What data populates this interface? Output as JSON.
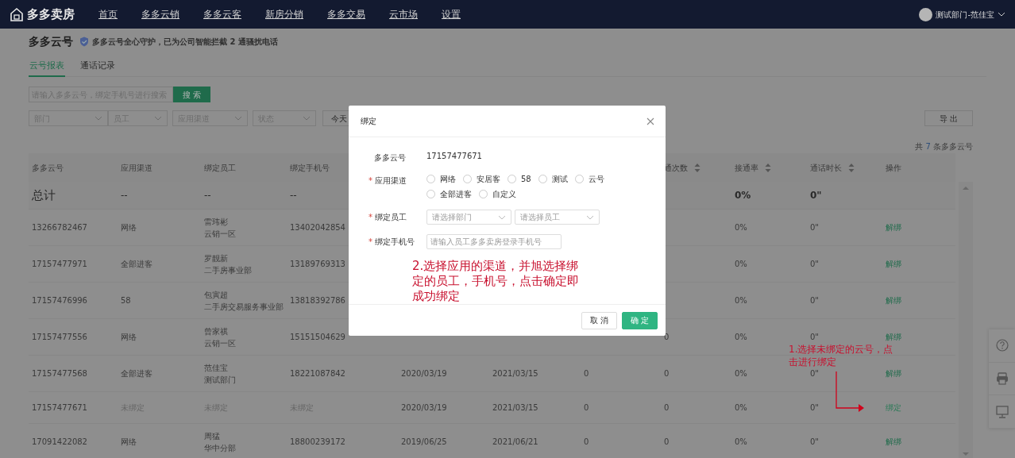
{
  "navbar": {
    "logo": "多多卖房",
    "items": [
      "首页",
      "多多云销",
      "多多云客",
      "新房分销",
      "多多交易",
      "云市场",
      "设置"
    ],
    "user": "测试部门-范佳宝"
  },
  "page": {
    "title": "多多云号",
    "notice": "多多云号全心守护，已为公司智能拦截 2 通骚扰电话"
  },
  "tabs": [
    {
      "label": "云号报表",
      "selected": true
    },
    {
      "label": "通话记录",
      "selected": false
    }
  ],
  "search": {
    "placeholder": "请输入多多云号，绑定手机号进行搜索",
    "button": "搜 索"
  },
  "filters": [
    {
      "placeholder": "部门"
    },
    {
      "placeholder": "员工"
    },
    {
      "placeholder": "应用渠道"
    },
    {
      "placeholder": "状态"
    }
  ],
  "date_buttons": [
    "今天"
  ],
  "export_button": "导 出",
  "total_count": {
    "prefix": "共",
    "count": "7",
    "suffix": "条多多云号"
  },
  "table": {
    "columns": {
      "number": {
        "label": "多多云号",
        "sortable": false
      },
      "channel": {
        "label": "应用渠道",
        "sortable": false
      },
      "employee": {
        "label": "绑定员工",
        "sortable": false
      },
      "phone": {
        "label": "绑定手机号",
        "sortable": false
      },
      "call_count": {
        "label": "通次数",
        "sortable": true
      },
      "rate": {
        "label": "接通率",
        "sortable": true
      },
      "duration": {
        "label": "通话时长",
        "sortable": true
      },
      "action": {
        "label": "操作",
        "sortable": false
      }
    },
    "totals": {
      "number": "总计",
      "channel": "--",
      "employee": "--",
      "phone": "--",
      "rate": "0%",
      "duration": "0\""
    },
    "rows": [
      {
        "bound": true,
        "number": "13266782467",
        "channel": "网络",
        "employee": [
          "雷玮彬",
          "云销一区"
        ],
        "phone": "13402042854",
        "rate": "0%",
        "duration": "0\"",
        "action": "解绑"
      },
      {
        "bound": true,
        "number": "17157477971",
        "channel": "全部进客",
        "employee": [
          "罗靓新",
          "二手房事业部"
        ],
        "phone": "13189769313",
        "rate": "0%",
        "duration": "0\"",
        "action": "解绑"
      },
      {
        "bound": true,
        "number": "17157476996",
        "channel": "58",
        "employee": [
          "包寅超",
          "二手房交易服务事业部"
        ],
        "phone": "13818392786",
        "rate": "0%",
        "duration": "0\"",
        "action": "解绑"
      },
      {
        "bound": true,
        "number": "17157477556",
        "channel": "网络",
        "employee": [
          "曾家祺",
          "云销一区"
        ],
        "phone": "15151504629",
        "call_count": "0",
        "rate": "0%",
        "duration": "0\"",
        "action": "解绑"
      },
      {
        "bound": true,
        "number": "17157477568",
        "channel": "全部进客",
        "employee": [
          "范佳宝",
          "测试部门"
        ],
        "phone": "18221087842",
        "bind_date": "2020/03/19",
        "expiry_date": "2021/03/15",
        "column_7": "0",
        "call_count": "0",
        "rate": "0%",
        "duration": "0\"",
        "action": "解绑"
      },
      {
        "bound": false,
        "number": "17157477671",
        "channel": "未绑定",
        "employee": "未绑定",
        "phone": "未绑定",
        "bind_date": "2020/03/19",
        "expiry_date": "2021/03/15",
        "column_7": "0",
        "call_count": "0",
        "rate": "0%",
        "duration": "0\"",
        "action": "绑定"
      },
      {
        "bound": true,
        "number": "17091422082",
        "channel": "网络",
        "employee": [
          "周猛",
          "华中分部"
        ],
        "phone": "18800239172",
        "bind_date": "2019/06/25",
        "expiry_date": "2021/06/21",
        "column_7": "0",
        "call_count": "0",
        "rate": "0%",
        "duration": "0\"",
        "action": "解绑"
      }
    ]
  },
  "modal": {
    "title": "绑定",
    "fields": [
      {
        "kind": "text",
        "label": "多多云号",
        "value": "17157477671"
      },
      {
        "kind": "radio",
        "required_mark": "*",
        "label": "应用渠道",
        "options": [
          {
            "label": "网络",
            "selected": false
          },
          {
            "label": "安居客",
            "selected": false
          },
          {
            "label": "58",
            "selected": false
          },
          {
            "label": "测试",
            "selected": false
          },
          {
            "label": "云号",
            "selected": false
          },
          {
            "label": "全部进客",
            "selected": false
          },
          {
            "label": "自定义",
            "selected": false
          }
        ]
      },
      {
        "kind": "selects",
        "required_mark": "*",
        "label": "绑定员工",
        "placeholders": [
          "请选择部门",
          "请选择员工"
        ]
      },
      {
        "kind": "input",
        "required_mark": "*",
        "label": "绑定手机号",
        "placeholder": "请输入员工多多卖房登录手机号"
      }
    ],
    "note": "2.选择应用的渠道，并旭选择绑定的员工，手机号，点击确定即成功绑定",
    "buttons": [
      {
        "label": "取 消",
        "kind": "secondary"
      },
      {
        "label": "确 定",
        "kind": "primary"
      }
    ]
  },
  "annotation": "1.选择未绑定的云号，点击进行绑定"
}
